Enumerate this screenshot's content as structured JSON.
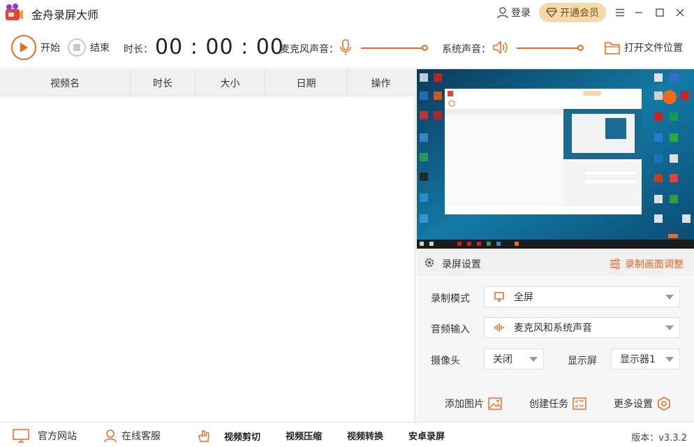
{
  "app": {
    "title": "金舟录屏大师"
  },
  "titlebar": {
    "login": "登录",
    "vip": "开通会员"
  },
  "toolbar": {
    "start": "开始",
    "stop": "结束",
    "duration_label": "时长：",
    "timer": "00 : 00 : 00",
    "mic_label": "麦克风声音：",
    "system_label": "系统声音：",
    "open_folder": "打开文件位置"
  },
  "list": {
    "columns": [
      "视频名",
      "时长",
      "大小",
      "日期",
      "操作"
    ]
  },
  "settings": {
    "title": "录屏设置",
    "adjust": "录制画面调整",
    "mode_label": "录制模式",
    "mode_value": "全屏",
    "audio_label": "音频输入",
    "audio_value": "麦克风和系统声音",
    "camera_label": "摄像头",
    "camera_value": "关闭",
    "display_label": "显示屏",
    "display_value": "显示器1",
    "add_image": "添加图片",
    "create_task": "创建任务",
    "more_settings": "更多设置"
  },
  "footer": {
    "website": "官方网站",
    "support": "在线客服",
    "edit": "视频剪切",
    "compress": "视频压缩",
    "convert": "视频转换",
    "android": "安卓录屏",
    "version": "版本：v3.3.2"
  },
  "colors": {
    "accent": "#f0671d",
    "vip_bg": "#f6d9ab",
    "preview_bg": "#0d4c6d"
  }
}
